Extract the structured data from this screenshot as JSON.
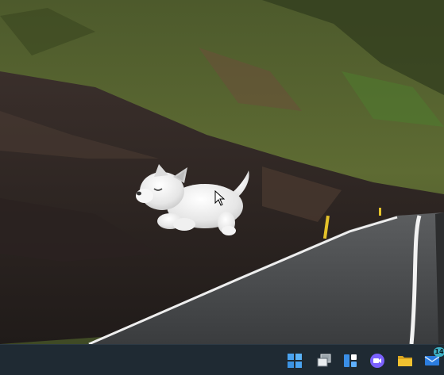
{
  "taskbar": {
    "icons": [
      {
        "name": "start-icon"
      },
      {
        "name": "task-view-icon"
      },
      {
        "name": "widgets-icon"
      },
      {
        "name": "chat-icon"
      },
      {
        "name": "file-explorer-icon"
      },
      {
        "name": "mail-icon",
        "badge": "14"
      }
    ]
  },
  "colors": {
    "taskbar_bg": "#1f2a33",
    "start_blue": "#4aa3f0",
    "chat_purple": "#7b61ff",
    "folder_yellow": "#f2c230",
    "mail_blue": "#2b7de0"
  }
}
